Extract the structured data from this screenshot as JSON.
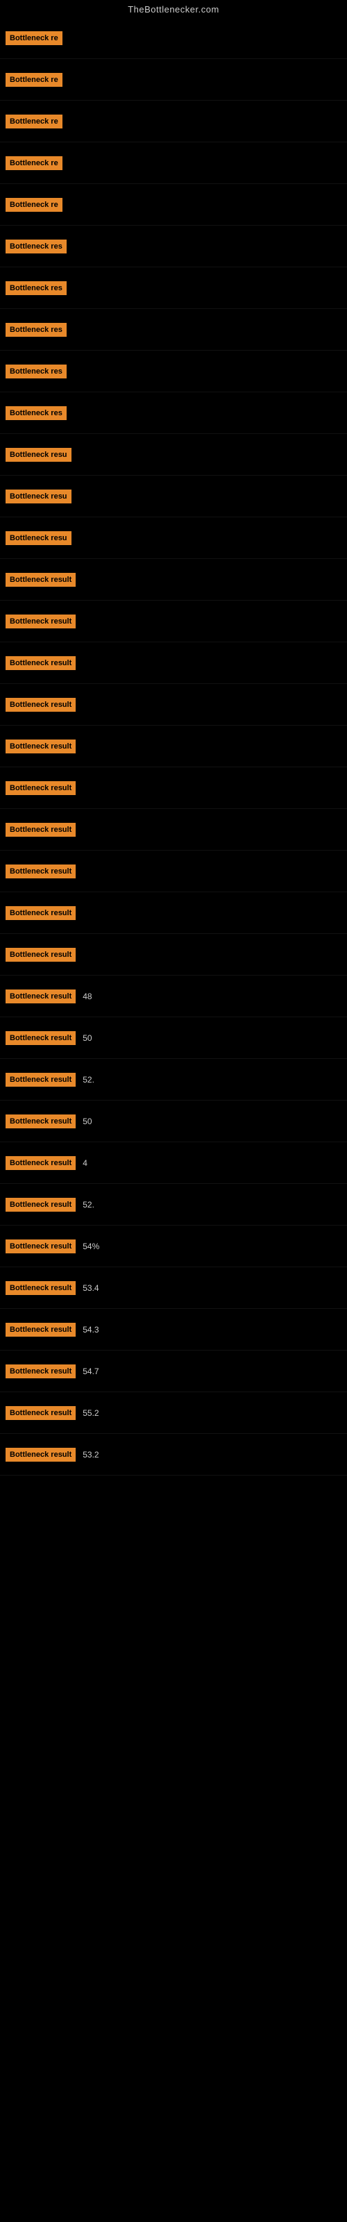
{
  "site": {
    "title": "TheBottlenecker.com"
  },
  "rows": [
    {
      "label": "Bottleneck re",
      "value": ""
    },
    {
      "label": "Bottleneck re",
      "value": ""
    },
    {
      "label": "Bottleneck re",
      "value": ""
    },
    {
      "label": "Bottleneck re",
      "value": ""
    },
    {
      "label": "Bottleneck re",
      "value": ""
    },
    {
      "label": "Bottleneck res",
      "value": ""
    },
    {
      "label": "Bottleneck res",
      "value": ""
    },
    {
      "label": "Bottleneck res",
      "value": ""
    },
    {
      "label": "Bottleneck res",
      "value": ""
    },
    {
      "label": "Bottleneck res",
      "value": ""
    },
    {
      "label": "Bottleneck resu",
      "value": ""
    },
    {
      "label": "Bottleneck resu",
      "value": ""
    },
    {
      "label": "Bottleneck resu",
      "value": ""
    },
    {
      "label": "Bottleneck result",
      "value": ""
    },
    {
      "label": "Bottleneck result",
      "value": ""
    },
    {
      "label": "Bottleneck result",
      "value": ""
    },
    {
      "label": "Bottleneck result",
      "value": ""
    },
    {
      "label": "Bottleneck result",
      "value": ""
    },
    {
      "label": "Bottleneck result",
      "value": ""
    },
    {
      "label": "Bottleneck result",
      "value": ""
    },
    {
      "label": "Bottleneck result",
      "value": ""
    },
    {
      "label": "Bottleneck result",
      "value": ""
    },
    {
      "label": "Bottleneck result",
      "value": ""
    },
    {
      "label": "Bottleneck result",
      "value": "48"
    },
    {
      "label": "Bottleneck result",
      "value": "50"
    },
    {
      "label": "Bottleneck result",
      "value": "52."
    },
    {
      "label": "Bottleneck result",
      "value": "50"
    },
    {
      "label": "Bottleneck result",
      "value": "4"
    },
    {
      "label": "Bottleneck result",
      "value": "52."
    },
    {
      "label": "Bottleneck result",
      "value": "54%"
    },
    {
      "label": "Bottleneck result",
      "value": "53.4"
    },
    {
      "label": "Bottleneck result",
      "value": "54.3"
    },
    {
      "label": "Bottleneck result",
      "value": "54.7"
    },
    {
      "label": "Bottleneck result",
      "value": "55.2"
    },
    {
      "label": "Bottleneck result",
      "value": "53.2"
    }
  ]
}
